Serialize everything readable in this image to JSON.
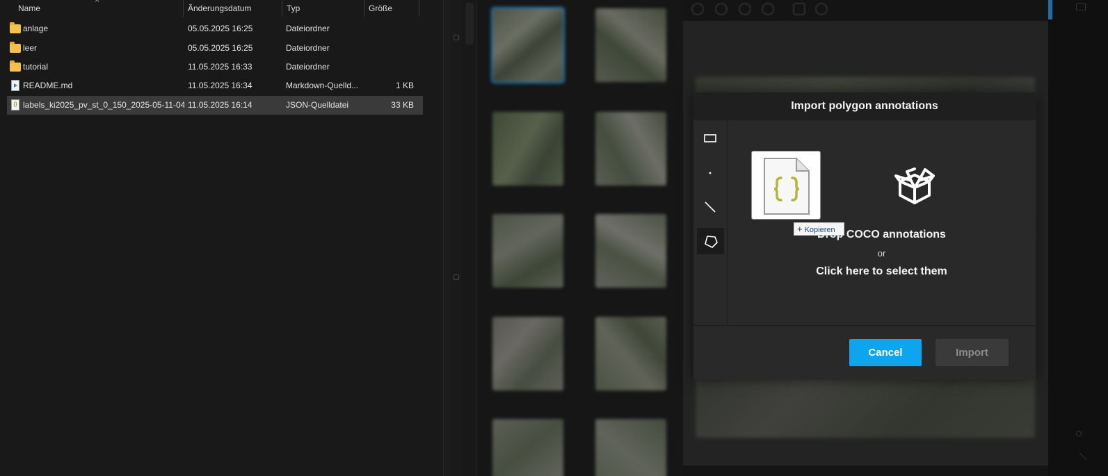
{
  "explorer": {
    "columns": {
      "name": "Name",
      "modified": "Änderungsdatum",
      "type": "Typ",
      "size": "Größe"
    },
    "files": [
      {
        "icon": "folder-icon",
        "name": "anlage",
        "modified": "05.05.2025 16:25",
        "type": "Dateiordner",
        "size": ""
      },
      {
        "icon": "folder-icon",
        "name": "leer",
        "modified": "05.05.2025 16:25",
        "type": "Dateiordner",
        "size": ""
      },
      {
        "icon": "folder-icon",
        "name": "tutorial",
        "modified": "11.05.2025 16:33",
        "type": "Dateiordner",
        "size": ""
      },
      {
        "icon": "markdown-file-icon",
        "name": "README.md",
        "modified": "11.05.2025 16:34",
        "type": "Markdown-Quelld...",
        "size": "1 KB"
      },
      {
        "icon": "json-file-icon",
        "name": "labels_ki2025_pv_st_0_150_2025-05-11-04...",
        "modified": "11.05.2025 16:14",
        "type": "JSON-Quelldatei",
        "size": "33 KB",
        "selected": true
      }
    ]
  },
  "modal": {
    "title": "Import polygon annotations",
    "tools": [
      "rectangle-tool-icon",
      "point-tool-icon",
      "line-tool-icon",
      "polygon-tool-icon"
    ],
    "active_tool": "polygon",
    "drop_text": "Drop COCO annotations",
    "or_text": "or",
    "select_text": "Click here to select them",
    "cancel_label": "Cancel",
    "import_label": "Import",
    "colors": {
      "cancel_button": "#0ea5f0",
      "import_button_disabled": "#3a3a3a"
    }
  },
  "drag": {
    "copy_tooltip": "Kopieren",
    "ghost_icon": "json-file-icon"
  }
}
